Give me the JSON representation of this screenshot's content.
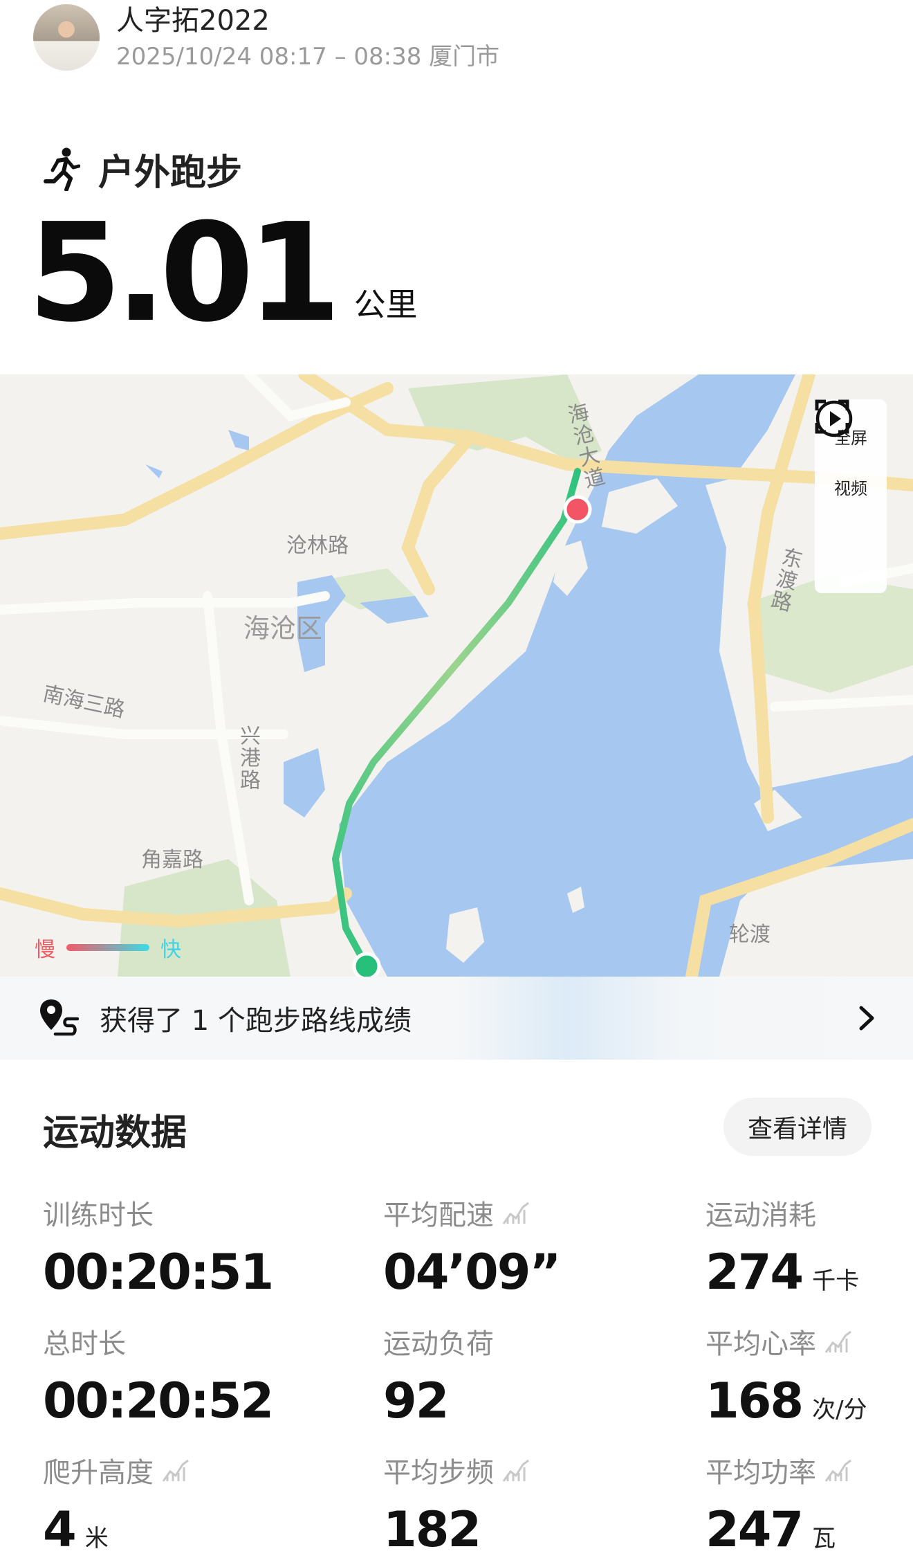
{
  "header": {
    "username": "人字拓2022",
    "subtitle": "2025/10/24 08:17 – 08:38 厦门市"
  },
  "workout": {
    "sport": "户外跑步",
    "distance": "5.01",
    "distance_unit": "公里"
  },
  "map": {
    "labels": {
      "canglin_road": "沧林路",
      "haicang_district": "海沧区",
      "nanhai_3rd_road": "南海三路",
      "xinggang_road": "兴港路",
      "jiaojia_road": "角嘉路",
      "haicang_avenue": "海沧大道",
      "dongdu_road": "东渡路",
      "ferry": "轮渡"
    },
    "fullscreen_label": "全屏",
    "video_label": "视频",
    "legend_slow": "慢",
    "legend_fast": "快",
    "route_color_start": "#2ec27e",
    "route_color_end": "#f25a65",
    "water_color": "#a6c8f0"
  },
  "record_banner": {
    "text": "获得了 1 个跑步路线成绩"
  },
  "stats": {
    "title": "运动数据",
    "detail_button": "查看详情",
    "items": [
      {
        "label": "训练时长",
        "value": "00:20:51",
        "unit": ""
      },
      {
        "label": "平均配速",
        "value": "04’09”",
        "unit": ""
      },
      {
        "label": "运动消耗",
        "value": "274",
        "unit": "千卡"
      },
      {
        "label": "总时长",
        "value": "00:20:52",
        "unit": ""
      },
      {
        "label": "运动负荷",
        "value": "92",
        "unit": ""
      },
      {
        "label": "平均心率",
        "value": "168",
        "unit": "次/分"
      },
      {
        "label": "爬升高度",
        "value": "4",
        "unit": "米"
      },
      {
        "label": "平均步频",
        "value": "182",
        "unit": ""
      },
      {
        "label": "平均功率",
        "value": "247",
        "unit": "瓦"
      }
    ]
  }
}
